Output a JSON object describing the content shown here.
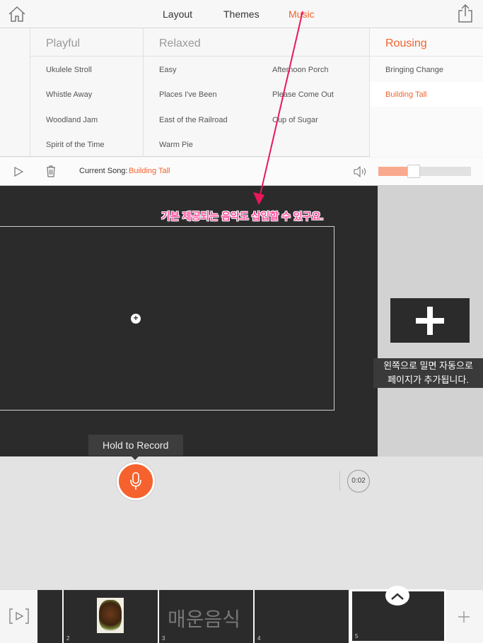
{
  "topbar": {
    "tabs": [
      {
        "label": "Layout",
        "active": false
      },
      {
        "label": "Themes",
        "active": false
      },
      {
        "label": "Music",
        "active": true
      }
    ],
    "accent_color": "#f5622d"
  },
  "music": {
    "categories": [
      {
        "name": "Playful",
        "active": false
      },
      {
        "name": "Relaxed",
        "active": false
      },
      {
        "name": "Rousing",
        "active": true
      }
    ],
    "playful_songs": [
      "Ukulele Stroll",
      "Whistle Away",
      "Woodland Jam",
      "Spirit of the Time"
    ],
    "relaxed_songs_a": [
      "Easy",
      "Places I've Been",
      "East of the Railroad",
      "Warm Pie"
    ],
    "relaxed_songs_b": [
      "Afternoon Porch",
      "Please Come Out",
      "Cup of Sugar"
    ],
    "rousing_songs": [
      "Bringing Change",
      "Building Tall"
    ],
    "selected_song": "Building Tall"
  },
  "songbar": {
    "current_label": "Current Song:",
    "current_song": "Building Tall",
    "volume_level": 0.31
  },
  "stage": {
    "annotation_music": "기본 제공되는 음악도 삽입할 수 있구요.",
    "annotation_page_line1": "왼쪽으로 밀면 자동으로",
    "annotation_page_line2": "페이지가 추가됩니다."
  },
  "recorder": {
    "tooltip": "Hold to Record",
    "timer": "0:02"
  },
  "timeline": {
    "pages": [
      "2",
      "3",
      "4",
      "5"
    ],
    "slide3_text": "매운음식"
  }
}
